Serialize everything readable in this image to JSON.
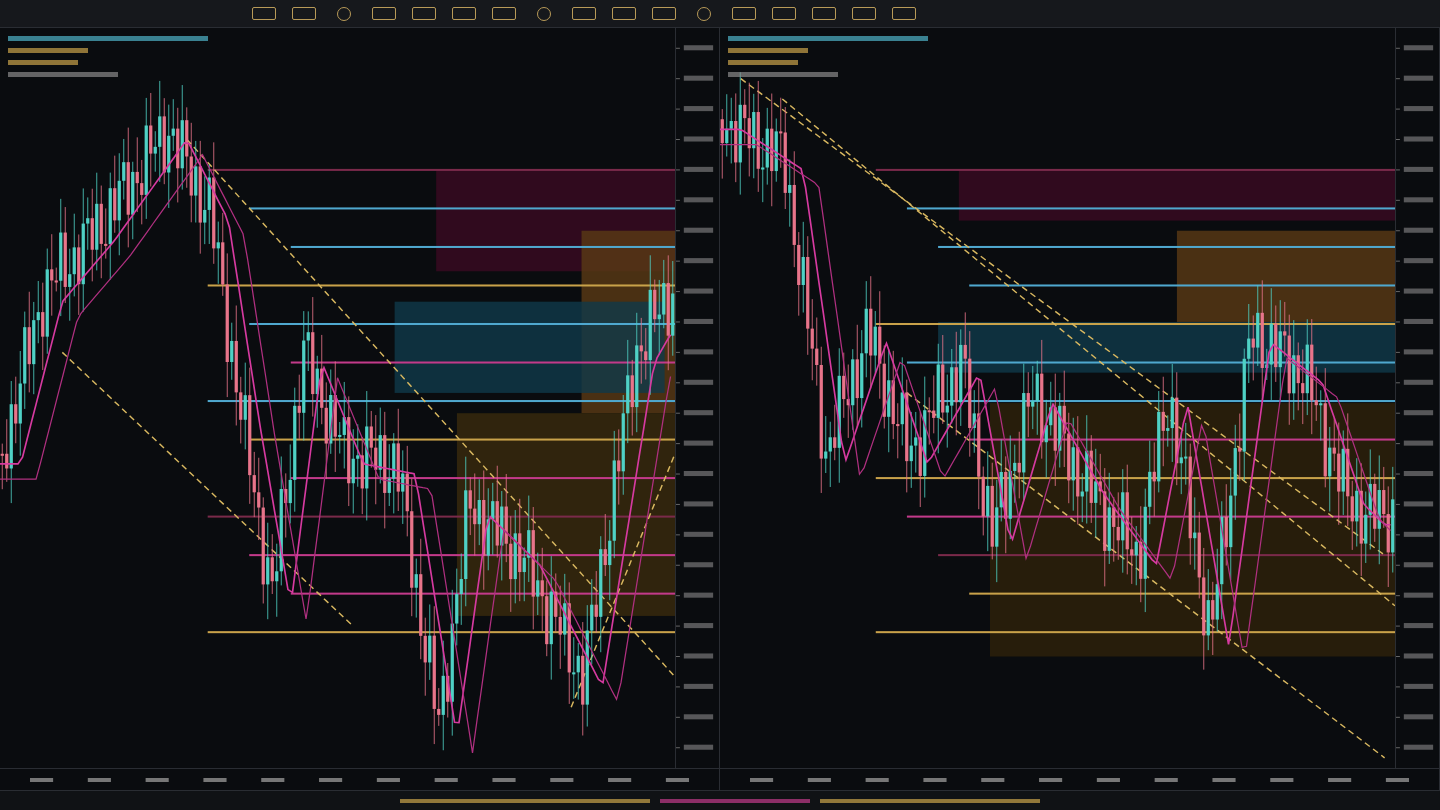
{
  "toolbar": {
    "icons": [
      {
        "kind": "box"
      },
      {
        "kind": "box"
      },
      {
        "kind": "circle"
      },
      {
        "kind": "box"
      },
      {
        "kind": "box"
      },
      {
        "kind": "box"
      },
      {
        "kind": "box"
      },
      {
        "kind": "circle"
      },
      {
        "kind": "box"
      },
      {
        "kind": "box"
      },
      {
        "kind": "box"
      },
      {
        "kind": "circle"
      },
      {
        "kind": "box"
      },
      {
        "kind": "box"
      },
      {
        "kind": "box"
      },
      {
        "kind": "box"
      },
      {
        "kind": "box"
      }
    ]
  },
  "panels": [
    {
      "kind": "rebound",
      "levels": [
        {
          "color": "#7a2a4a"
        },
        {
          "color": "#4fa8cf"
        },
        {
          "color": "#4fa8cf"
        },
        {
          "color": "#c9a24a"
        },
        {
          "color": "#4fa8cf"
        },
        {
          "color": "#c23a8a"
        },
        {
          "color": "#4fa8cf"
        },
        {
          "color": "#c9a24a"
        },
        {
          "color": "#c23a8a"
        },
        {
          "color": "#7a2a4a"
        },
        {
          "color": "#c23a8a"
        },
        {
          "color": "#c23a8a"
        },
        {
          "color": "#c9a24a"
        }
      ]
    },
    {
      "kind": "downtrend",
      "levels": [
        {
          "color": "#7a2a4a"
        },
        {
          "color": "#4fa8cf"
        },
        {
          "color": "#4fa8cf"
        },
        {
          "color": "#4fa8cf"
        },
        {
          "color": "#c9a24a"
        },
        {
          "color": "#4fa8cf"
        },
        {
          "color": "#4fa8cf"
        },
        {
          "color": "#c23a8a"
        },
        {
          "color": "#c9a24a"
        },
        {
          "color": "#c23a8a"
        },
        {
          "color": "#7a2a4a"
        },
        {
          "color": "#c9a24a"
        },
        {
          "color": "#c9a24a"
        }
      ]
    }
  ]
}
